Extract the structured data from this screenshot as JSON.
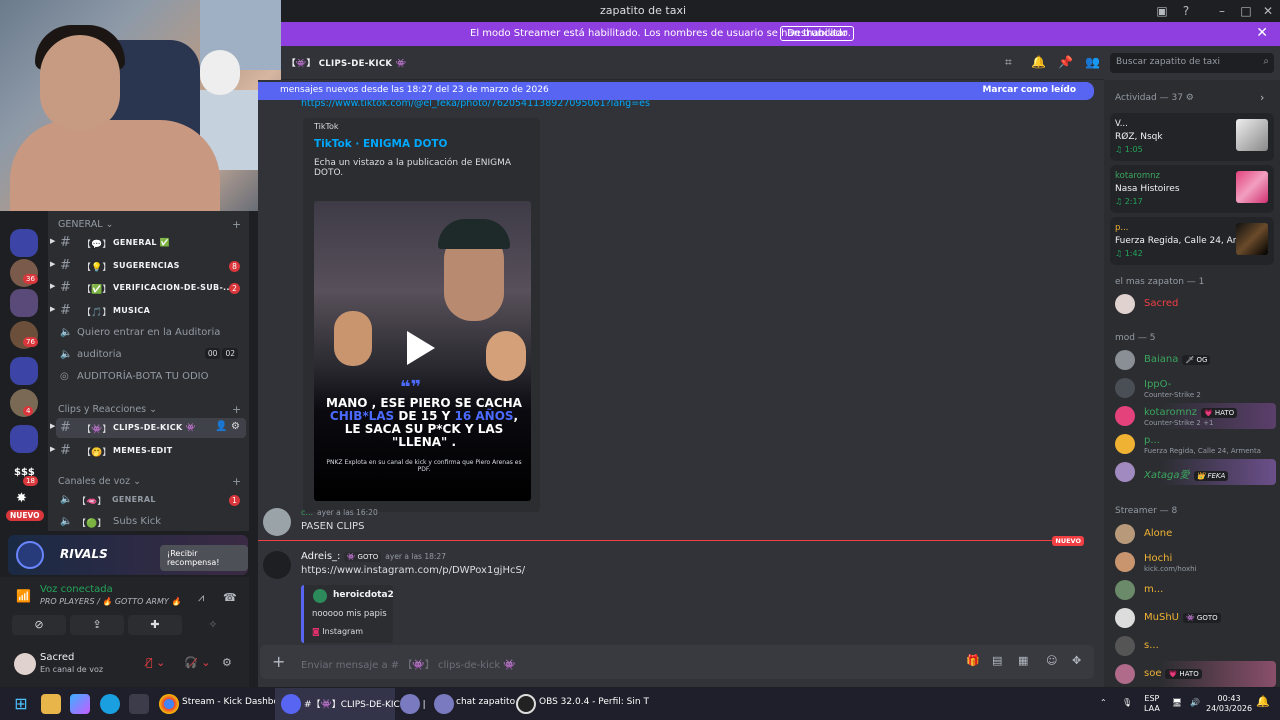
{
  "window": {
    "title": "zapatito de taxi"
  },
  "banner": {
    "message": "El modo Streamer está habilitado. Los nombres de usuario se han truncado.",
    "button": "Deshabilitar"
  },
  "rail": {
    "badges": [
      "36",
      "76",
      "4",
      "18"
    ],
    "dollar": "$$$",
    "new_label": "NUEVO"
  },
  "channels": {
    "cat_general": "GENERAL",
    "general": [
      {
        "emoji": "【💬】",
        "name": "GENERAL ✅",
        "badge": ""
      },
      {
        "emoji": "【💡】",
        "name": "SUGERENCIAS",
        "badge": "8"
      },
      {
        "emoji": "【✅】",
        "name": "VERIFICACION-DE-SUB-...",
        "badge": "2"
      },
      {
        "emoji": "【🎵】",
        "name": "MUSICA",
        "badge": ""
      }
    ],
    "voice1": "Quiero entrar en la Auditoria",
    "voice2": "auditoria",
    "voice2_tags": [
      "00",
      "02"
    ],
    "voice3": "AUDITORÍA-BOTA TU ODIO",
    "cat_clips": "Clips y Reacciones",
    "clips": {
      "emoji": "【👾】",
      "name": "CLIPS-DE-KICK 👾"
    },
    "memes": {
      "emoji": "【🤭】",
      "name": "MEMES-EDIT"
    },
    "cat_voice": "Canales de voz",
    "voice_general": {
      "emoji": "【🫦】",
      "name": "GENERAL",
      "badge": "1"
    },
    "subs_kick": {
      "emoji": "【🟢】",
      "name": "Subs Kick"
    }
  },
  "promo": {
    "brand": "RIVALS",
    "button": "¡Recibir recompensa!"
  },
  "voice": {
    "status": "Voz conectada",
    "server": "PRO PLAYERS / 🔥 GOTTO ARMY 🔥"
  },
  "user": {
    "name": "Sacred",
    "status": "En canal de voz"
  },
  "chat_header": {
    "channel": "【👾】 CLIPS-DE-KICK 👾"
  },
  "search": {
    "placeholder": "Buscar zapatito de taxi"
  },
  "newbar": {
    "text": "mensajes nuevos desde las 18:27 del 23 de marzo de 2026",
    "action": "Marcar como leído"
  },
  "messages": {
    "top_link": "https://www.tiktok.com/@el_feka/photo/7620541138927095061?lang=es",
    "embed": {
      "provider": "TikTok",
      "title": "TikTok · ENIGMA DOTO",
      "description": "Echa un vistazo a la publicación de ENIGMA DOTO.",
      "headline_a": "MANO , ESE PIERO SE CACHA",
      "headline_hl1": "CHIB*LAS",
      "headline_b": "DE 15 Y",
      "headline_hl2": "16 AÑOS",
      "headline_c": ", LE SACA SU P*CK Y LAS \"LLENA\" .",
      "caption": "PNKZ Explota en su canal de kick y confirma que Piero Arenas es PDF."
    },
    "m1": {
      "author": "c...",
      "time": "ayer a las 16:20",
      "text": "PASEN CLIPS"
    },
    "new_tag": "NUEVO",
    "m2": {
      "author": "Adreis_:",
      "tag": "👾 GOTO",
      "time": "ayer a las 18:27",
      "text": "https://www.instagram.com/p/DWPox1gjHcS/"
    },
    "reply": {
      "name": "heroicdota2",
      "text": "nooooo mis papis",
      "source": "Instagram"
    }
  },
  "composer": {
    "placeholder": "Enviar mensaje a # 【👾】 clips-de-kick 👾"
  },
  "members": {
    "activity_header": "Actividad — 37",
    "activities": [
      {
        "user": "V...",
        "song": "RØZ, Nsqk",
        "time": "1:05"
      },
      {
        "user": "kotaromnz",
        "song": "Nasa Histoires",
        "time": "2:17"
      },
      {
        "user": "p...",
        "song": "Fuerza Regida, Calle 24, Ar...",
        "time": "1:42"
      }
    ],
    "group1": "el mas zapaton — 1",
    "g1": [
      {
        "name": "Sacred",
        "color": "#f23f43"
      }
    ],
    "group2": "mod — 5",
    "g2": [
      {
        "name": "Baiana",
        "tag": "🗡 OG",
        "status": "",
        "color": "#3ba55d"
      },
      {
        "name": "IppO-",
        "tag": "",
        "status": "Counter-Strike 2",
        "color": "#3ba55d"
      },
      {
        "name": "kotaromnz",
        "tag": "💗 HATO",
        "status": "Counter-Strike 2 +1",
        "color": "#3ba55d"
      },
      {
        "name": "p...",
        "tag": "",
        "status": "Fuerza Regida, Calle 24, Armenta",
        "color": "#3ba55d"
      },
      {
        "name": "Xataga愛",
        "tag": "👑 FEKA",
        "status": "",
        "color": "#3ba55d"
      }
    ],
    "group3": "Streamer — 8",
    "g3": [
      {
        "name": "Alone",
        "tag": "",
        "status": "",
        "color": "#f0b232"
      },
      {
        "name": "Hochi",
        "tag": "",
        "status": "kick.com/hoxhi",
        "color": "#f0b232"
      },
      {
        "name": "m...",
        "tag": "",
        "status": "",
        "color": "#f0b232"
      },
      {
        "name": "MuShU",
        "tag": "👾 GOTO",
        "status": "",
        "color": "#f0b232"
      },
      {
        "name": "s...",
        "tag": "",
        "status": "",
        "color": "#f0b232"
      },
      {
        "name": "soe",
        "tag": "💗 HATO",
        "status": "",
        "color": "#f0b232"
      }
    ]
  },
  "taskbar": {
    "items": [
      "Stream - Kick Dashboar",
      "#【👾】CLIPS-DE-KICK 👾 |",
      "chat zapatito",
      "OBS 32.0.4 - Perfil: Sin T"
    ],
    "lang1": "ESP",
    "lang2": "LAA",
    "time": "00:43",
    "date": "24/03/2026"
  }
}
